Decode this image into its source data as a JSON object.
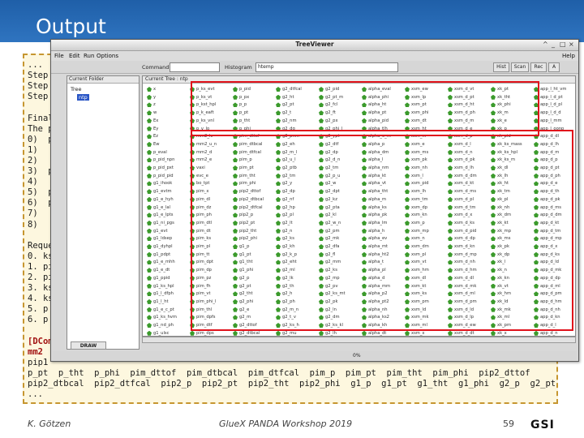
{
  "slide": {
    "title": "Output",
    "author": "K. Götzen",
    "conference": "GlueX PANDA Workshop 2019",
    "page": "59",
    "logo": "GSI",
    "header_color": "#2a6ab4"
  },
  "terminal": {
    "lines": [
      {
        "text": "...",
        "red": false
      },
      {
        "text": "Step",
        "red": false
      },
      {
        "text": "Step",
        "red": false
      },
      {
        "text": "Step",
        "red": false
      },
      {
        "text": "",
        "red": false
      },
      {
        "text": "Final",
        "red": false
      },
      {
        "text": "The p",
        "red": false
      },
      {
        "text": "0)  p",
        "red": false
      },
      {
        "text": "1)",
        "red": false
      },
      {
        "text": "2)",
        "red": false
      },
      {
        "text": "3)  p",
        "red": false
      },
      {
        "text": "4)",
        "red": false
      },
      {
        "text": "5)  p",
        "red": false
      },
      {
        "text": "6)  p",
        "red": false
      },
      {
        "text": "7)",
        "red": false
      },
      {
        "text": "8)",
        "red": false
      },
      {
        "text": "",
        "red": false
      },
      {
        "text": "Reque",
        "red": false
      },
      {
        "text": "0. ks",
        "red": false
      },
      {
        "text": "1. pi",
        "red": false
      },
      {
        "text": "2. pi",
        "red": false
      },
      {
        "text": "3. ks",
        "red": false
      },
      {
        "text": "4. ks",
        "red": false
      },
      {
        "text": "5. p",
        "red": false
      },
      {
        "text": "6. p",
        "red": false
      },
      {
        "text": "",
        "red": false
      },
      {
        "text": "[DCom",
        "red": true
      },
      {
        "text": "mm2",
        "red": true
      },
      {
        "text": "pip1",
        "red": false
      },
      {
        "text": "p_pt  p_tht  p_phi  pim_dttof  pim_dtbcal  pim_dtfcal  pim_p  pim_pt  pim_tht  pim_phi  pip2_dttof",
        "red": false
      },
      {
        "text": "pip2_dtbcal  pip2_dtfcal  pip2_p  pip2_pt  pip2_tht  pip2_phi  g1_p  g1_pt  g1_tht  g1_phi  g2_p  g2_pt",
        "red": false
      },
      {
        "text": "...",
        "red": false
      }
    ]
  },
  "window": {
    "title": "TreeViewer",
    "controls": [
      "^",
      "_",
      "□",
      "×"
    ],
    "menu": [
      "File",
      "Edit",
      "Run",
      "Options",
      "Help"
    ],
    "toolbar": {
      "command_label": "Command",
      "histogram_label": "Histogram",
      "histogram_value": "htemp",
      "buttons": [
        "Hist",
        "Scan",
        "Rec",
        "A"
      ]
    },
    "left_pane": {
      "header": "Current Folder",
      "items": [
        {
          "label": "Tree",
          "selected": false
        },
        {
          "label": "ntp",
          "selected": true
        }
      ]
    },
    "right_pane_header": "Current Tree : ntp",
    "status_progress": "0%",
    "draw_button": "DRAW",
    "leaf_columns": [
      [
        "x",
        "y",
        "z",
        "w",
        "Ex",
        "Ey",
        "Ez",
        "Ew",
        "p_eval",
        "p_pid_npn",
        "p_pid_pxt",
        "p_pid_pid",
        "g1_ihook",
        "g1_evtm",
        "g1_e_hyh",
        "g1_e_lal",
        "g1_e_lpts",
        "g1_ni_pgs",
        "g1_evt",
        "g1_ldsep",
        "g1_dyhpl",
        "g1_pdpt",
        "g1_e_mhh",
        "g1_e_dt",
        "g1_ppid",
        "g1_ks_hpl",
        "g1_l_dfph",
        "g1_l_ht",
        "g1_e_c_pt",
        "g1_ks_hvm",
        "g1_nd_ph",
        "g1_ulsc"
      ],
      [
        "p_ks_evt",
        "p_ks_vt",
        "p_kst_hpl",
        "p_k_eaft",
        "p_ks_vnl",
        "p_v_lo",
        "mm2_lc",
        "mm2_u_n",
        "mm2_d",
        "mm2_e",
        "vaxi",
        "evc_e",
        "bo_tpt",
        "pim_x",
        "pim_dl",
        "pim_dz",
        "pim_ph",
        "pim_dtl",
        "pim_dt",
        "pim_ks",
        "pim_pl",
        "pim_tt",
        "pim_dpt",
        "pim_dp",
        "pim_pz",
        "pim_fh",
        "pim_vt",
        "pim_phi_l",
        "pim_thl",
        "pim_dpfs",
        "pim_dtf",
        "pim_dps"
      ],
      [
        "p_pid",
        "p_px",
        "p_p",
        "p_pt",
        "p_tht",
        "p_phi",
        "pim_dttof",
        "pim_dtbcal",
        "pim_dtfcal",
        "pim_p",
        "pim_pt",
        "pim_tht",
        "pim_phi",
        "pip2_dttof",
        "pip2_dtbcal",
        "pip2_dtfcal",
        "pip2_p",
        "pip2_pt",
        "pip2_tht",
        "pip2_phi",
        "g1_p",
        "g1_pt",
        "g1_tht",
        "g1_phi",
        "g2_p",
        "g2_pt",
        "g2_tht",
        "g2_phi",
        "g2_e",
        "g2_m",
        "g2_dttof",
        "g2_dtbcal"
      ],
      [
        "g2_dtfcal",
        "g2_ht",
        "g2_pt",
        "g2_t",
        "g2_nm",
        "g2_dg",
        "g2_pnm",
        "g2_eh",
        "g2_m_l",
        "g2_u_l",
        "g2_ptb",
        "g2_tm",
        "g2_y",
        "g2_dp",
        "g2_nf",
        "g2_hp",
        "g2_pl",
        "g2_lt",
        "g2_n",
        "g2_ks",
        "g2_kh",
        "g2_k_p",
        "g2_eht",
        "g2_ml",
        "g2_lk",
        "g2_th",
        "g2_h",
        "g2_ph",
        "g2_m_n",
        "g2_t_v",
        "g2_ks_h",
        "g2_mu"
      ],
      [
        "g2_pid",
        "g2_pt_m",
        "g2_fcl",
        "g2_ft",
        "g2_px",
        "g2_phi_l",
        "g2_ypt",
        "g2_dtf",
        "g2_dp",
        "g2_d_n",
        "g2_tm",
        "g2_p_u",
        "g2_w",
        "g2_dpt",
        "g2_kz",
        "g2_pta",
        "g2_kl",
        "g2_w_n",
        "g2_pm",
        "g2_mk",
        "g2_dfa",
        "g2_fl",
        "g2_mm",
        "g2_ks",
        "g2_mp",
        "g2_pv",
        "g2_ks_mt",
        "g2_pk",
        "g2_ln",
        "g2_dm",
        "g2_ks_kl",
        "g2_lh"
      ],
      [
        "alpha_eval",
        "alpha_phi",
        "alpha_ht",
        "alpha_pt",
        "alpha_pid",
        "alpha_tlh",
        "alpha_e_m",
        "alpha_p",
        "alpha_dm",
        "alpha_l",
        "alpha_nm",
        "alpha_kt",
        "alpha_vt",
        "alpha_tht",
        "alpha_m",
        "alpha_ks",
        "alpha_pk",
        "alpha_lm",
        "alpha_h",
        "alpha_ev",
        "alpha_mt",
        "alpha_ht2",
        "alpha_t",
        "alpha_pl",
        "alpha_d",
        "alpha_mm",
        "alpha_p2",
        "alpha_pt2",
        "alpha_nh",
        "alpha_ks2",
        "alpha_kh",
        "alpha_dt"
      ],
      [
        "xsm_ew",
        "xsm_lp",
        "xsm_pt",
        "xsm_phi",
        "xsm_dt",
        "xsm_ht",
        "xsm_m",
        "xsm_e",
        "xsm_ms",
        "xsm_pk",
        "xsm_nh",
        "xsm_l",
        "xsm_pid",
        "xsm_lh",
        "xsm_tm",
        "xsm_dp",
        "xsm_kn",
        "xsm_p",
        "xsm_mp",
        "xsm_n",
        "xsm_dm",
        "xsm_pl",
        "xsm_vt",
        "xsm_hm",
        "xsm_dl",
        "xsm_kt",
        "xsm_ks",
        "xsm_pm",
        "xsm_ld",
        "xsm_mk",
        "xsm_ml",
        "xsm_x"
      ],
      [
        "xsm_d_vt",
        "xsm_d_pt",
        "xsm_d_ht",
        "xsm_d_ph",
        "xsm_d_m",
        "xsm_d_e",
        "xsm_d_p",
        "xsm_d_l",
        "xsm_d_n",
        "xsm_d_pk",
        "xsm_d_lh",
        "xsm_d_dm",
        "xsm_d_kt",
        "xsm_d_ms",
        "xsm_d_pl",
        "xsm_d_tm",
        "xsm_d_x",
        "xsm_d_ks",
        "xsm_d_pid",
        "xsm_d_dp",
        "xsm_d_kn",
        "xsm_d_mp",
        "xsm_d_nh",
        "xsm_d_hm",
        "xsm_d_dl",
        "xsm_d_mk",
        "xsm_d_ml",
        "xsm_d_pm",
        "xsm_d_ld",
        "xsm_d_lp",
        "xsm_d_ew",
        "xsm_d_dt"
      ],
      [
        "xk_pt",
        "xk_tht",
        "xk_phi",
        "xk_m",
        "xk_e",
        "xk_p",
        "xk_pid",
        "xk_ks_mass",
        "xk_ks_hpl",
        "xk_ks_m",
        "xk_dl",
        "xk_lh",
        "xk_ht",
        "xk_tm",
        "xk_pl",
        "xk_nh",
        "xk_dm",
        "xk_kt",
        "xk_mp",
        "xk_ms",
        "xk_pk",
        "xk_dp",
        "xk_l",
        "xk_n",
        "xk_kn",
        "xk_vt",
        "xk_hm",
        "xk_ld",
        "xk_mk",
        "xk_ml",
        "xk_pm",
        "xk_x"
      ],
      [
        "app_l_ht_vm",
        "app_l_d_pt",
        "app_l_d_pl",
        "app_l_d_d",
        "app_l_mm",
        "app_l_oonp",
        "app_d_dl",
        "app_d_lh",
        "app_d_m",
        "app_d_p",
        "app_d_pt",
        "app_d_ph",
        "app_d_e",
        "app_d_th",
        "app_d_pk",
        "app_d_ms",
        "app_d_dm",
        "app_d_kt",
        "app_d_tm",
        "app_d_mp",
        "app_d_x",
        "app_d_ks",
        "app_d_ld",
        "app_d_mk",
        "app_d_dp",
        "app_d_ml",
        "app_d_pm",
        "app_d_hm",
        "app_d_nh",
        "app_d_kn",
        "app_d_l",
        "app_d_n"
      ]
    ]
  },
  "highlight_color": "#e0121b"
}
